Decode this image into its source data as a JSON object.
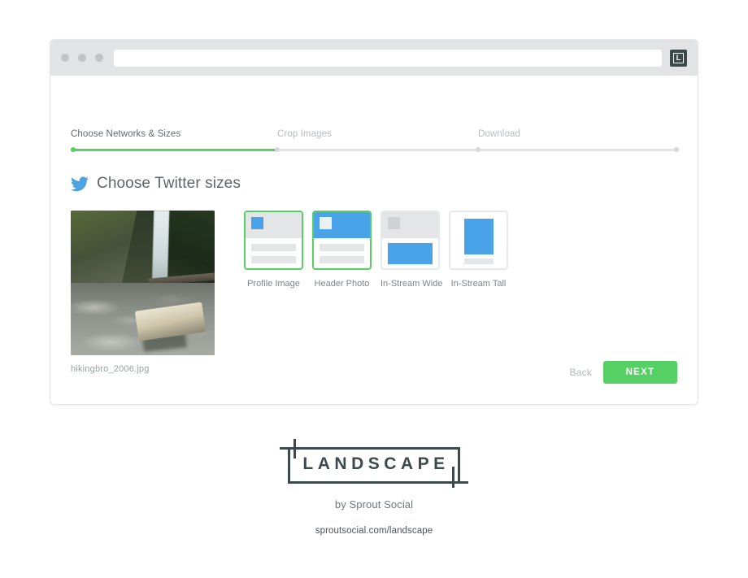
{
  "browser": {
    "dots": [
      "window-dot",
      "window-dot",
      "window-dot"
    ],
    "url_value": "",
    "url_placeholder": "",
    "app_badge": {
      "icon": "landscape-l-icon",
      "letter": "L"
    }
  },
  "stepper": {
    "steps": [
      {
        "label": "Choose Networks & Sizes",
        "state": "active"
      },
      {
        "label": "Crop Images",
        "state": "upcoming"
      },
      {
        "label": "Download",
        "state": "upcoming"
      }
    ],
    "progress_percent": 34,
    "fill_color": "#55d065",
    "track_color": "#e2e4e5"
  },
  "section": {
    "icon": "twitter-bird-icon",
    "icon_color": "#4ea2e0",
    "title": "Choose Twitter sizes"
  },
  "photo": {
    "filename": "hikingbro_2006.jpg",
    "alt": "waterfall-photo"
  },
  "sizes": [
    {
      "label": "Profile Image",
      "selected": true,
      "thumb": "profile-image-thumb"
    },
    {
      "label": "Header Photo",
      "selected": true,
      "thumb": "header-photo-thumb"
    },
    {
      "label": "In-Stream Wide",
      "selected": false,
      "thumb": "in-stream-wide-thumb"
    },
    {
      "label": "In-Stream Tall",
      "selected": false,
      "thumb": "in-stream-tall-thumb"
    }
  ],
  "actions": {
    "back_label": "Back",
    "next_label": "NEXT",
    "next_color": "#55d065"
  },
  "footer": {
    "logo_text": "LANDSCAPE",
    "byline": "by Sprout Social",
    "url": "sproutsocial.com/landscape",
    "logo_color": "#3d4a4a"
  }
}
